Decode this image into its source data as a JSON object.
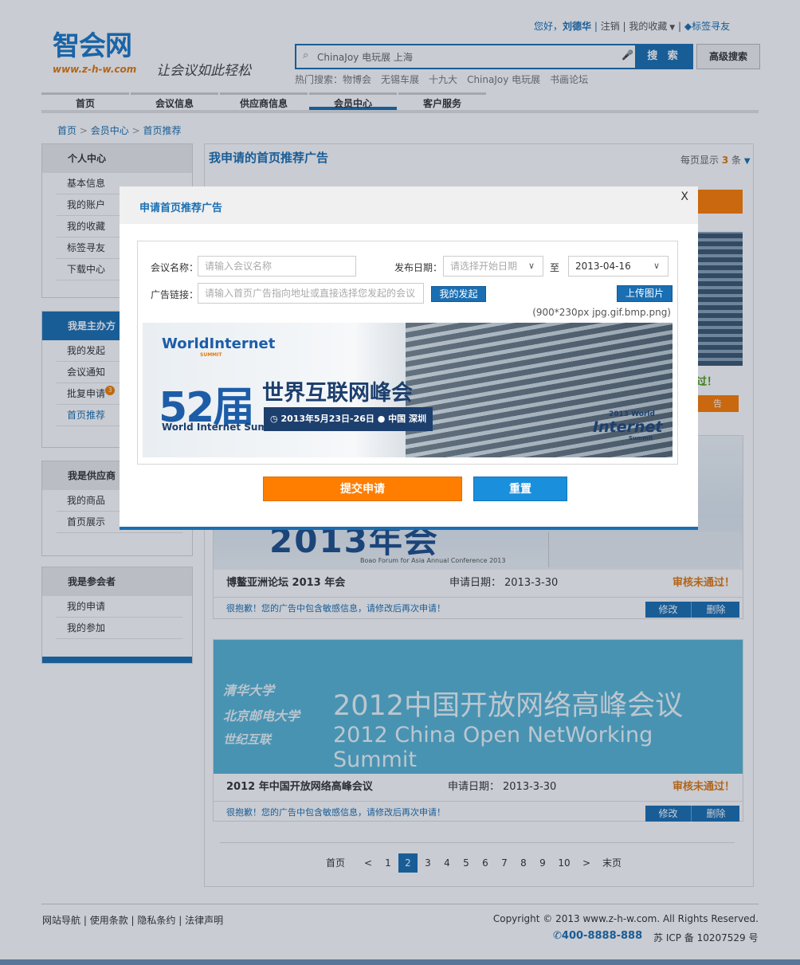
{
  "header": {
    "logo_text": "智会网",
    "logo_url": "www.z-h-w.com",
    "slogan": "让会议如此轻松",
    "greeting": "您好，",
    "username": "刘德华",
    "logout": "注销",
    "favorites": "我的收藏",
    "tag_friends": "标签寻友",
    "search_value": "ChinaJoy 电玩展 上海",
    "search_button": "搜 索",
    "advanced_search": "高级搜索",
    "hot_label": "热门搜索：",
    "hot_items": [
      "物博会",
      "无锡车展",
      "十九大",
      "ChinaJoy 电玩展",
      "书画论坛"
    ]
  },
  "nav": {
    "items": [
      "首页",
      "会议信息",
      "供应商信息",
      "会员中心",
      "客户服务"
    ],
    "active_index": 3
  },
  "breadcrumb": [
    "首页",
    "会员中心",
    "首页推荐"
  ],
  "sidebar": {
    "sections": [
      {
        "title": "个人中心",
        "items": [
          "基本信息",
          "我的账户",
          "我的收藏",
          "标签寻友",
          "下载中心"
        ]
      },
      {
        "title": "我是主办方",
        "items": [
          "我的发起",
          "会议通知",
          "批复申请",
          "首页推荐"
        ],
        "badge": "3"
      },
      {
        "title": "我是供应商",
        "items": [
          "我的商品",
          "首页展示"
        ]
      },
      {
        "title": "我是参会者",
        "items": [
          "我的申请",
          "我的参加"
        ]
      }
    ],
    "active_item": "首页推荐"
  },
  "main": {
    "title": "我申请的首页推荐广告",
    "per_page_label": "每页显示",
    "per_page_value": "3",
    "per_page_unit": "条",
    "partial_status": "过！",
    "partial_button": "告",
    "cards": [
      {
        "banner_cn": "2013年会",
        "banner_en": "Boao Forum for Asia Annual Conference 2013",
        "name": "博鳌亚洲论坛 2013 年会",
        "date_label": "申请日期：",
        "date": "2013-3-30",
        "status": "审核未通过！",
        "message": "很抱歉！您的广告中包含敏感信息，请修改后再次申请！",
        "edit": "修改",
        "delete": "删除"
      },
      {
        "banner_cn": "2012中国开放网络高峰会议",
        "banner_en": "2012 China Open NetWorking Summit",
        "banner_logos": [
          "清华大学",
          "北京邮电大学",
          "世纪互联"
        ],
        "name": "2012 年中国开放网络高峰会议",
        "date_label": "申请日期：",
        "date": "2013-3-30",
        "status": "审核未通过！",
        "message": "很抱歉！您的广告中包含敏感信息，请修改后再次申请！",
        "edit": "修改",
        "delete": "删除"
      }
    ]
  },
  "pagination": {
    "first": "首页",
    "prev": "<",
    "pages": [
      "1",
      "2",
      "3",
      "4",
      "5",
      "6",
      "7",
      "8",
      "9",
      "10"
    ],
    "current": "2",
    "next": ">",
    "last": "末页"
  },
  "footer": {
    "links": [
      "网站导航",
      "使用条款",
      "隐私条约",
      "法律声明"
    ],
    "copyright": "Copyright © 2013 www.z-h-w.com. All Rights Reserved.",
    "phone": "400-8888-888",
    "icp": "苏 ICP 备 10207529 号"
  },
  "modal": {
    "title": "申请首页推荐广告",
    "close": "X",
    "name_label": "会议名称：",
    "name_placeholder": "请输入会议名称",
    "date_label": "发布日期：",
    "start_placeholder": "请选择开始日期",
    "to_label": "至",
    "end_value": "2013-04-16",
    "link_label": "广告链接：",
    "link_placeholder": "请输入首页广告指向地址或直接选择您发起的会议",
    "my_launch": "我的发起",
    "upload": "上传图片",
    "size_hint": "(900*230px jpg.gif.bmp.png)",
    "preview": {
      "brand": "WorldInternet",
      "brand_sub": "SUMMIT",
      "edition": "52届",
      "title_cn": "世界互联网峰会",
      "subtitle_en": "World Internet Summit",
      "date_place": "2013年5月23日-26日",
      "city": "中国 深圳",
      "corner_year": "2013 World",
      "corner_name": "Internet",
      "corner_sub": "Summit"
    },
    "submit": "提交申请",
    "reset": "重置"
  },
  "colors": {
    "primary_blue": "#1a6fb3",
    "orange": "#ff7e00",
    "status_orange": "#e07a10"
  }
}
